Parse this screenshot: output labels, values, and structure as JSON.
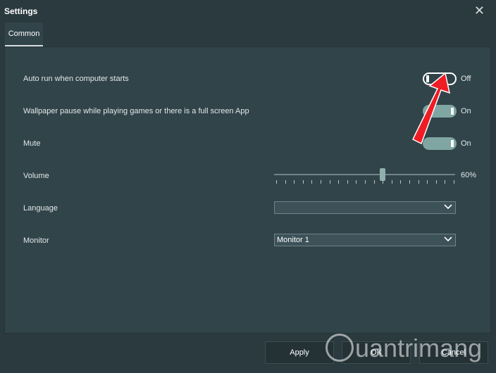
{
  "window": {
    "title": "Settings"
  },
  "tabs": [
    {
      "label": "Common"
    }
  ],
  "settings": {
    "auto_run": {
      "label": "Auto run when computer starts",
      "state": "Off"
    },
    "wallpaper_pause": {
      "label": "Wallpaper pause while playing games or there is a full screen App",
      "state": "On"
    },
    "mute": {
      "label": "Mute",
      "state": "On"
    },
    "volume": {
      "label": "Volume",
      "value_text": "60%",
      "value": 0.6
    },
    "language": {
      "label": "Language",
      "selected": ""
    },
    "monitor": {
      "label": "Monitor",
      "selected": "Monitor 1"
    }
  },
  "buttons": {
    "apply": "Apply",
    "ok": "OK",
    "cancel": "Cancel"
  },
  "watermark": {
    "text": "uantrimang"
  },
  "colors": {
    "toggle_on": "#7fa6a2",
    "arrow": "#ee1c25",
    "background": "#2a3a3e",
    "panel": "#31444a"
  }
}
